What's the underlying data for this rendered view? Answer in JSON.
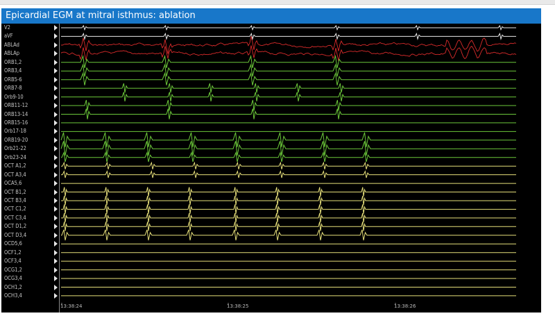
{
  "window": {
    "title": "Epicardial EGM at mitral isthmus: ablation"
  },
  "channels": [
    {
      "label": "V2",
      "color": "#e8e8e8",
      "kind": "surface"
    },
    {
      "label": "aVF",
      "color": "#e8e8e8",
      "kind": "surface"
    },
    {
      "label": "ABLAd",
      "color": "#d92b2b",
      "kind": "ablation"
    },
    {
      "label": "ABLAp",
      "color": "#d92b2b",
      "kind": "ablation"
    },
    {
      "label": "ORB1,2",
      "color": "#6cc83a",
      "kind": "orb_a"
    },
    {
      "label": "ORB3,4",
      "color": "#6cc83a",
      "kind": "orb_a"
    },
    {
      "label": "ORB5-6",
      "color": "#6cc83a",
      "kind": "orb_a"
    },
    {
      "label": "ORB7-8",
      "color": "#6cc83a",
      "kind": "orb_b"
    },
    {
      "label": "Orb9-10",
      "color": "#6cc83a",
      "kind": "orb_b"
    },
    {
      "label": "ORB11-12",
      "color": "#6cc83a",
      "kind": "orb_c"
    },
    {
      "label": "ORB13-14",
      "color": "#6cc83a",
      "kind": "orb_c"
    },
    {
      "label": "ORB15-16",
      "color": "#6cc83a",
      "kind": "flat"
    },
    {
      "label": "Orb17-18",
      "color": "#6cc83a",
      "kind": "flat"
    },
    {
      "label": "ORB19-20",
      "color": "#6cc83a",
      "kind": "orb_big"
    },
    {
      "label": "Orb21-22",
      "color": "#6cc83a",
      "kind": "orb_big"
    },
    {
      "label": "Orb23-24",
      "color": "#6cc83a",
      "kind": "orb_small"
    },
    {
      "label": "OCT A1,2",
      "color": "#e6df7a",
      "kind": "oct_a"
    },
    {
      "label": "OCT A3,4",
      "color": "#e6df7a",
      "kind": "oct_a"
    },
    {
      "label": "OCA5,6",
      "color": "#e6df7a",
      "kind": "flat"
    },
    {
      "label": "OCT B1,2",
      "color": "#e6df7a",
      "kind": "oct_b"
    },
    {
      "label": "OCT B3,4",
      "color": "#e6df7a",
      "kind": "oct_b"
    },
    {
      "label": "OCT C1,2",
      "color": "#e6df7a",
      "kind": "oct_b"
    },
    {
      "label": "OCT C3,4",
      "color": "#e6df7a",
      "kind": "oct_b"
    },
    {
      "label": "OCT D1,2",
      "color": "#e6df7a",
      "kind": "oct_b"
    },
    {
      "label": "OCT D3,4",
      "color": "#e6df7a",
      "kind": "oct_big"
    },
    {
      "label": "OCD5,6",
      "color": "#e6df7a",
      "kind": "flat"
    },
    {
      "label": "OCF1,2",
      "color": "#e6df7a",
      "kind": "flat"
    },
    {
      "label": "OCF3,4",
      "color": "#e6df7a",
      "kind": "flat"
    },
    {
      "label": "OCG1,2",
      "color": "#e6df7a",
      "kind": "flat"
    },
    {
      "label": "OCG3,4",
      "color": "#e6df7a",
      "kind": "flat"
    },
    {
      "label": "OCH1,2",
      "color": "#e6df7a",
      "kind": "flat"
    },
    {
      "label": "OCH3,4",
      "color": "#e6df7a",
      "kind": "flat"
    }
  ],
  "timestamps": [
    "13:38:24",
    "13:38:25",
    "13:38:26"
  ]
}
